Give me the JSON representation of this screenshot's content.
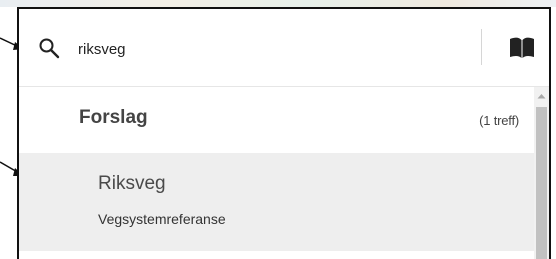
{
  "search": {
    "value": "riksveg",
    "icon": "search-icon"
  },
  "toolbar": {
    "icon": "book-icon"
  },
  "suggestions": {
    "title": "Forslag",
    "count": "(1 treff)",
    "items": [
      {
        "title": "Riksveg",
        "subtitle": "Vegsystemreferanse"
      }
    ]
  },
  "colors": {
    "selected_row": "#eeeeee",
    "border": "#111111",
    "scroll_thumb": "#c1c1c1"
  }
}
